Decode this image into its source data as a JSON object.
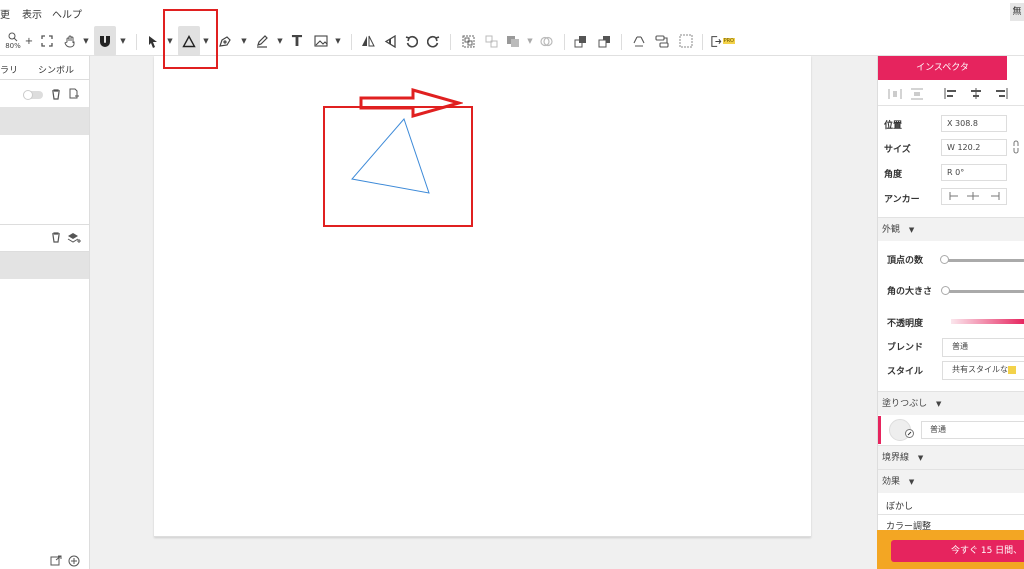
{
  "menu": {
    "item1": "表示",
    "item2": "ヘルプ",
    "partial_left": "更",
    "right_partial": "無"
  },
  "toolbar": {
    "zoom_level": "80%",
    "icons": [
      "zoom-icon",
      "fit-icon",
      "hand-icon",
      "magnet-icon",
      "select-arrow-icon",
      "triangle-tool-icon",
      "pen-tool-icon",
      "pencil-tool-icon",
      "text-tool-icon",
      "image-tool-icon",
      "flip-horizontal-icon",
      "flip-vertical-icon",
      "rotate-left-icon",
      "rotate-right-icon",
      "group-icon",
      "ungroup-icon",
      "arrange-icon",
      "boolean-icon",
      "bring-forward-icon",
      "send-backward-icon",
      "recycle-icon",
      "align-icon",
      "frame-icon",
      "export-icon"
    ],
    "text_tool_glyph": "T",
    "pro_badge": "PRO"
  },
  "left_panel": {
    "tab1": "ラリ",
    "tab2": "シンボル"
  },
  "inspector": {
    "tab_label": "インスペクタ",
    "position_label": "位置",
    "position_value": "X  308.8",
    "size_label": "サイズ",
    "size_value": "W  120.2",
    "angle_label": "角度",
    "angle_value": "R  0°",
    "anchor_label": "アンカー",
    "appearance_section": "外観",
    "vertex_label": "頂点の数",
    "corner_label": "角の大きさ",
    "opacity_label": "不透明度",
    "blend_label": "ブレンド",
    "blend_value": "普通",
    "style_label": "スタイル",
    "style_value": "共有スタイルな",
    "fill_section": "塗りつぶし",
    "fill_value": "普通",
    "stroke_section": "境界線",
    "effect_section": "効果",
    "blur_label": "ぼかし",
    "color_adjust_label": "カラー調整",
    "accent_color": "#e6245e"
  },
  "trial": {
    "button_label": "今すぐ 15 日間、"
  },
  "annotation_color": "#e02020"
}
